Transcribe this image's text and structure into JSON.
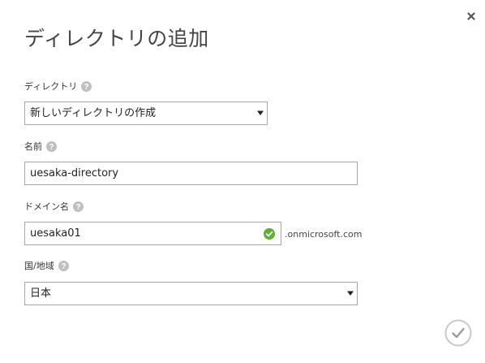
{
  "dialog": {
    "title": "ディレクトリの追加",
    "close_icon": "close-icon",
    "submit_icon": "checkmark-circle-icon"
  },
  "directory": {
    "label": "ディレクトリ",
    "help_icon": "help-icon",
    "selected_value": "新しいディレクトリの作成"
  },
  "name": {
    "label": "名前",
    "help_icon": "help-icon",
    "value": "uesaka-directory"
  },
  "domain": {
    "label": "ドメイン名",
    "help_icon": "help-icon",
    "value": "uesaka01",
    "valid_icon": "valid-check-icon",
    "suffix": ".onmicrosoft.com"
  },
  "region": {
    "label": "国/地域",
    "help_icon": "help-icon",
    "selected_value": "日本"
  },
  "colors": {
    "help_icon": "#bfbfbf",
    "valid_icon": "#5cb130",
    "field_border": "#a6a6a6",
    "submit_ring": "#c8c8c8",
    "title_text": "#444444"
  }
}
